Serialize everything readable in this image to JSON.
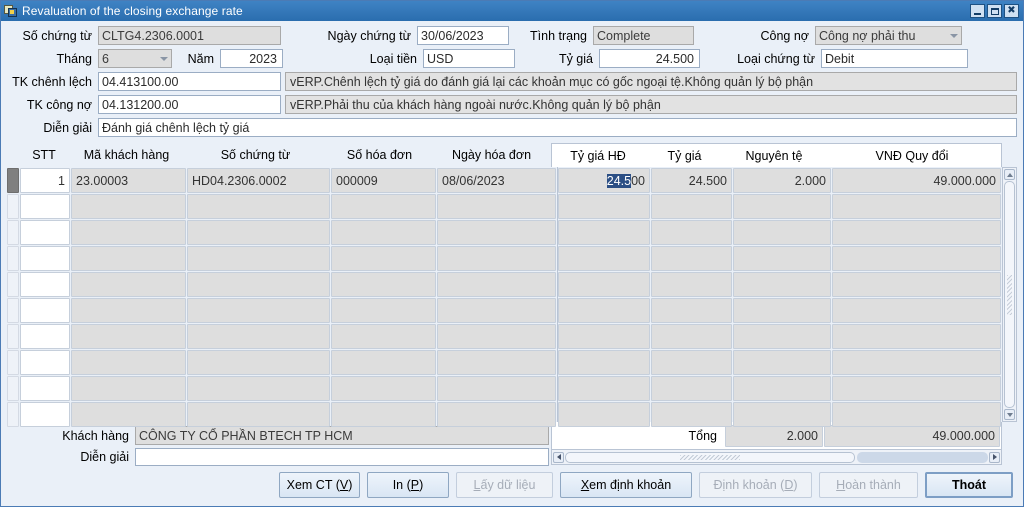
{
  "window": {
    "title": "Revaluation of the closing exchange rate",
    "icon": "app-window-icon",
    "buttons": {
      "minimize": "minimize-icon",
      "maximize": "maximize-icon",
      "close": "close-icon"
    }
  },
  "form": {
    "so_chung_tu_label": "Số chứng từ",
    "so_chung_tu_value": "CLTG4.2306.0001",
    "ngay_chung_tu_label": "Ngày chứng từ",
    "ngay_chung_tu_value": "30/06/2023",
    "tinh_trang_label": "Tình trạng",
    "tinh_trang_value": "Complete",
    "cong_no_label": "Công nợ",
    "cong_no_value": "Công nợ phải thu",
    "thang_label": "Tháng",
    "thang_value": "6",
    "nam_label": "Năm",
    "nam_value": "2023",
    "loai_tien_label": "Loại tiền",
    "loai_tien_value": "USD",
    "ty_gia_label": "Tỷ giá",
    "ty_gia_value": "24.500",
    "loai_chung_tu_label": "Loại chứng từ",
    "loai_chung_tu_value": "Debit",
    "tk_chenh_lech_label": "TK chênh lệch",
    "tk_chenh_lech_value": "04.413100.00",
    "tk_chenh_lech_desc": "vERP.Chênh lệch tỷ giá do đánh giá lại các khoản mục có gốc ngoại tệ.Không quản lý bộ phận",
    "tk_cong_no_label": "TK công nợ",
    "tk_cong_no_value": "04.131200.00",
    "tk_cong_no_desc": "vERP.Phải thu của khách hàng ngoài nước.Không quản lý bộ phận",
    "dien_giai_label": "Diễn giải",
    "dien_giai_value": "Đánh giá chênh lệch tỷ giá"
  },
  "grid": {
    "columns_left": [
      "STT",
      "Mã khách hàng",
      "Số chứng từ",
      "Số hóa đơn",
      "Ngày hóa đơn"
    ],
    "columns_right": [
      "Tỷ giá HĐ",
      "Tỷ giá",
      "Nguyên tệ",
      "VNĐ Quy đổi"
    ],
    "rows": [
      {
        "stt": "1",
        "ma_khach_hang": "23.00003",
        "so_chung_tu": "HD04.2306.0002",
        "so_hoa_don": "000009",
        "ngay_hoa_don": "08/06/2023",
        "ty_gia_hd_selected": "24.5",
        "ty_gia_hd_rest": "00",
        "ty_gia": "24.500",
        "nguyen_te": "2.000",
        "vnd_quy_doi": "49.000.000"
      },
      {
        "stt": "",
        "ma_khach_hang": "",
        "so_chung_tu": "",
        "so_hoa_don": "",
        "ngay_hoa_don": "",
        "ty_gia_hd_selected": "",
        "ty_gia_hd_rest": "",
        "ty_gia": "",
        "nguyen_te": "",
        "vnd_quy_doi": ""
      },
      {
        "stt": "",
        "ma_khach_hang": "",
        "so_chung_tu": "",
        "so_hoa_don": "",
        "ngay_hoa_don": "",
        "ty_gia_hd_selected": "",
        "ty_gia_hd_rest": "",
        "ty_gia": "",
        "nguyen_te": "",
        "vnd_quy_doi": ""
      },
      {
        "stt": "",
        "ma_khach_hang": "",
        "so_chung_tu": "",
        "so_hoa_don": "",
        "ngay_hoa_don": "",
        "ty_gia_hd_selected": "",
        "ty_gia_hd_rest": "",
        "ty_gia": "",
        "nguyen_te": "",
        "vnd_quy_doi": ""
      },
      {
        "stt": "",
        "ma_khach_hang": "",
        "so_chung_tu": "",
        "so_hoa_don": "",
        "ngay_hoa_don": "",
        "ty_gia_hd_selected": "",
        "ty_gia_hd_rest": "",
        "ty_gia": "",
        "nguyen_te": "",
        "vnd_quy_doi": ""
      },
      {
        "stt": "",
        "ma_khach_hang": "",
        "so_chung_tu": "",
        "so_hoa_don": "",
        "ngay_hoa_don": "",
        "ty_gia_hd_selected": "",
        "ty_gia_hd_rest": "",
        "ty_gia": "",
        "nguyen_te": "",
        "vnd_quy_doi": ""
      },
      {
        "stt": "",
        "ma_khach_hang": "",
        "so_chung_tu": "",
        "so_hoa_don": "",
        "ngay_hoa_don": "",
        "ty_gia_hd_selected": "",
        "ty_gia_hd_rest": "",
        "ty_gia": "",
        "nguyen_te": "",
        "vnd_quy_doi": ""
      },
      {
        "stt": "",
        "ma_khach_hang": "",
        "so_chung_tu": "",
        "so_hoa_don": "",
        "ngay_hoa_don": "",
        "ty_gia_hd_selected": "",
        "ty_gia_hd_rest": "",
        "ty_gia": "",
        "nguyen_te": "",
        "vnd_quy_doi": ""
      },
      {
        "stt": "",
        "ma_khach_hang": "",
        "so_chung_tu": "",
        "so_hoa_don": "",
        "ngay_hoa_don": "",
        "ty_gia_hd_selected": "",
        "ty_gia_hd_rest": "",
        "ty_gia": "",
        "nguyen_te": "",
        "vnd_quy_doi": ""
      },
      {
        "stt": "",
        "ma_khach_hang": "",
        "so_chung_tu": "",
        "so_hoa_don": "",
        "ngay_hoa_don": "",
        "ty_gia_hd_selected": "",
        "ty_gia_hd_rest": "",
        "ty_gia": "",
        "nguyen_te": "",
        "vnd_quy_doi": ""
      }
    ]
  },
  "totals": {
    "khach_hang_label": "Khách hàng",
    "khach_hang_value": "CÔNG TY CỔ PHẦN BTECH TP HCM",
    "dien_giai_label": "Diễn giải",
    "dien_giai_value": "",
    "tong_label": "Tổng",
    "tong_nguyen_te": "2.000",
    "tong_vnd": "49.000.000"
  },
  "footer": {
    "xem_ct": {
      "pre": "Xem CT (",
      "key": "V",
      "post": ")",
      "disabled": false
    },
    "in": {
      "pre": "In (",
      "key": "P",
      "post": ")",
      "disabled": false
    },
    "lay_du_lieu": {
      "pre": "",
      "key": "L",
      "post": "ấy dữ liệu",
      "disabled": true
    },
    "xem_dinh_khoan": {
      "pre": "",
      "key": "X",
      "post": "em định khoản",
      "disabled": false
    },
    "dinh_khoan": {
      "pre": "Định khoản (",
      "key": "D",
      "post": ")",
      "disabled": true
    },
    "hoan_thanh": {
      "pre": "",
      "key": "H",
      "post": "oàn thành",
      "disabled": true
    },
    "thoat": {
      "pre": "Thoát",
      "key": "",
      "post": "",
      "disabled": false
    }
  }
}
